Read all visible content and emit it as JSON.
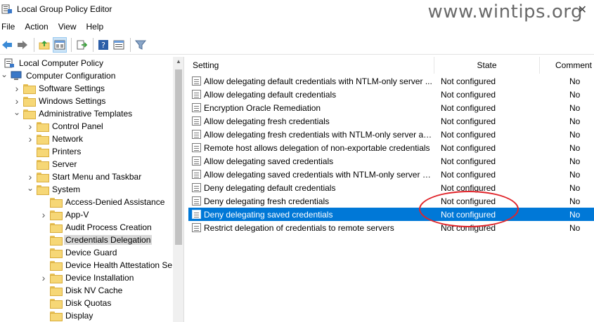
{
  "window": {
    "title": "Local Group Policy Editor",
    "watermark": "www.wintips.org",
    "close_glyph": "✕"
  },
  "menu": [
    "File",
    "Action",
    "View",
    "Help"
  ],
  "toolbar": {
    "icons": [
      "back-icon",
      "forward-icon",
      "up-folder-icon",
      "show-hide-tree-icon",
      "export-list-icon",
      "help-icon",
      "properties-icon",
      "filter-icon"
    ]
  },
  "tree": {
    "items": [
      {
        "label": "Local Computer Policy",
        "level": 0,
        "expander": "",
        "icon": "computer"
      },
      {
        "label": "Computer Configuration",
        "level": 1,
        "expander": "v",
        "icon": "computer"
      },
      {
        "label": "Software Settings",
        "level": 2,
        "expander": ">",
        "icon": "folder"
      },
      {
        "label": "Windows Settings",
        "level": 2,
        "expander": ">",
        "icon": "folder"
      },
      {
        "label": "Administrative Templates",
        "level": 2,
        "expander": "v",
        "icon": "folder"
      },
      {
        "label": "Control Panel",
        "level": 3,
        "expander": ">",
        "icon": "folder"
      },
      {
        "label": "Network",
        "level": 3,
        "expander": ">",
        "icon": "folder"
      },
      {
        "label": "Printers",
        "level": 3,
        "expander": "",
        "icon": "folder"
      },
      {
        "label": "Server",
        "level": 3,
        "expander": "",
        "icon": "folder"
      },
      {
        "label": "Start Menu and Taskbar",
        "level": 3,
        "expander": ">",
        "icon": "folder"
      },
      {
        "label": "System",
        "level": 3,
        "expander": "v",
        "icon": "folder"
      },
      {
        "label": "Access-Denied Assistance",
        "level": 4,
        "expander": "",
        "icon": "folder"
      },
      {
        "label": "App-V",
        "level": 4,
        "expander": ">",
        "icon": "folder"
      },
      {
        "label": "Audit Process Creation",
        "level": 4,
        "expander": "",
        "icon": "folder"
      },
      {
        "label": "Credentials Delegation",
        "level": 4,
        "expander": "",
        "icon": "folder",
        "selected": true
      },
      {
        "label": "Device Guard",
        "level": 4,
        "expander": "",
        "icon": "folder"
      },
      {
        "label": "Device Health Attestation Se",
        "level": 4,
        "expander": "",
        "icon": "folder"
      },
      {
        "label": "Device Installation",
        "level": 4,
        "expander": ">",
        "icon": "folder"
      },
      {
        "label": "Disk NV Cache",
        "level": 4,
        "expander": "",
        "icon": "folder"
      },
      {
        "label": "Disk Quotas",
        "level": 4,
        "expander": "",
        "icon": "folder"
      },
      {
        "label": "Display",
        "level": 4,
        "expander": "",
        "icon": "folder"
      }
    ]
  },
  "list": {
    "columns": {
      "setting": "Setting",
      "state": "State",
      "comment": "Comment"
    },
    "rows": [
      {
        "setting": "Allow delegating default credentials with NTLM-only server ...",
        "state": "Not configured",
        "comment": "No"
      },
      {
        "setting": "Allow delegating default credentials",
        "state": "Not configured",
        "comment": "No"
      },
      {
        "setting": "Encryption Oracle Remediation",
        "state": "Not configured",
        "comment": "No"
      },
      {
        "setting": "Allow delegating fresh credentials",
        "state": "Not configured",
        "comment": "No"
      },
      {
        "setting": "Allow delegating fresh credentials with NTLM-only server au...",
        "state": "Not configured",
        "comment": "No"
      },
      {
        "setting": "Remote host allows delegation of non-exportable credentials",
        "state": "Not configured",
        "comment": "No"
      },
      {
        "setting": "Allow delegating saved credentials",
        "state": "Not configured",
        "comment": "No"
      },
      {
        "setting": "Allow delegating saved credentials with NTLM-only server a...",
        "state": "Not configured",
        "comment": "No"
      },
      {
        "setting": "Deny delegating default credentials",
        "state": "Not configured",
        "comment": "No"
      },
      {
        "setting": "Deny delegating fresh credentials",
        "state": "Not configured",
        "comment": "No"
      },
      {
        "setting": "Deny delegating saved credentials",
        "state": "Not configured",
        "comment": "No",
        "selected": true
      },
      {
        "setting": "Restrict delegation of credentials to remote servers",
        "state": "Not configured",
        "comment": "No"
      }
    ]
  },
  "colors": {
    "selection": "#0078d7",
    "annotation": "#e0242a",
    "tree_selection": "#d9d9d9"
  }
}
